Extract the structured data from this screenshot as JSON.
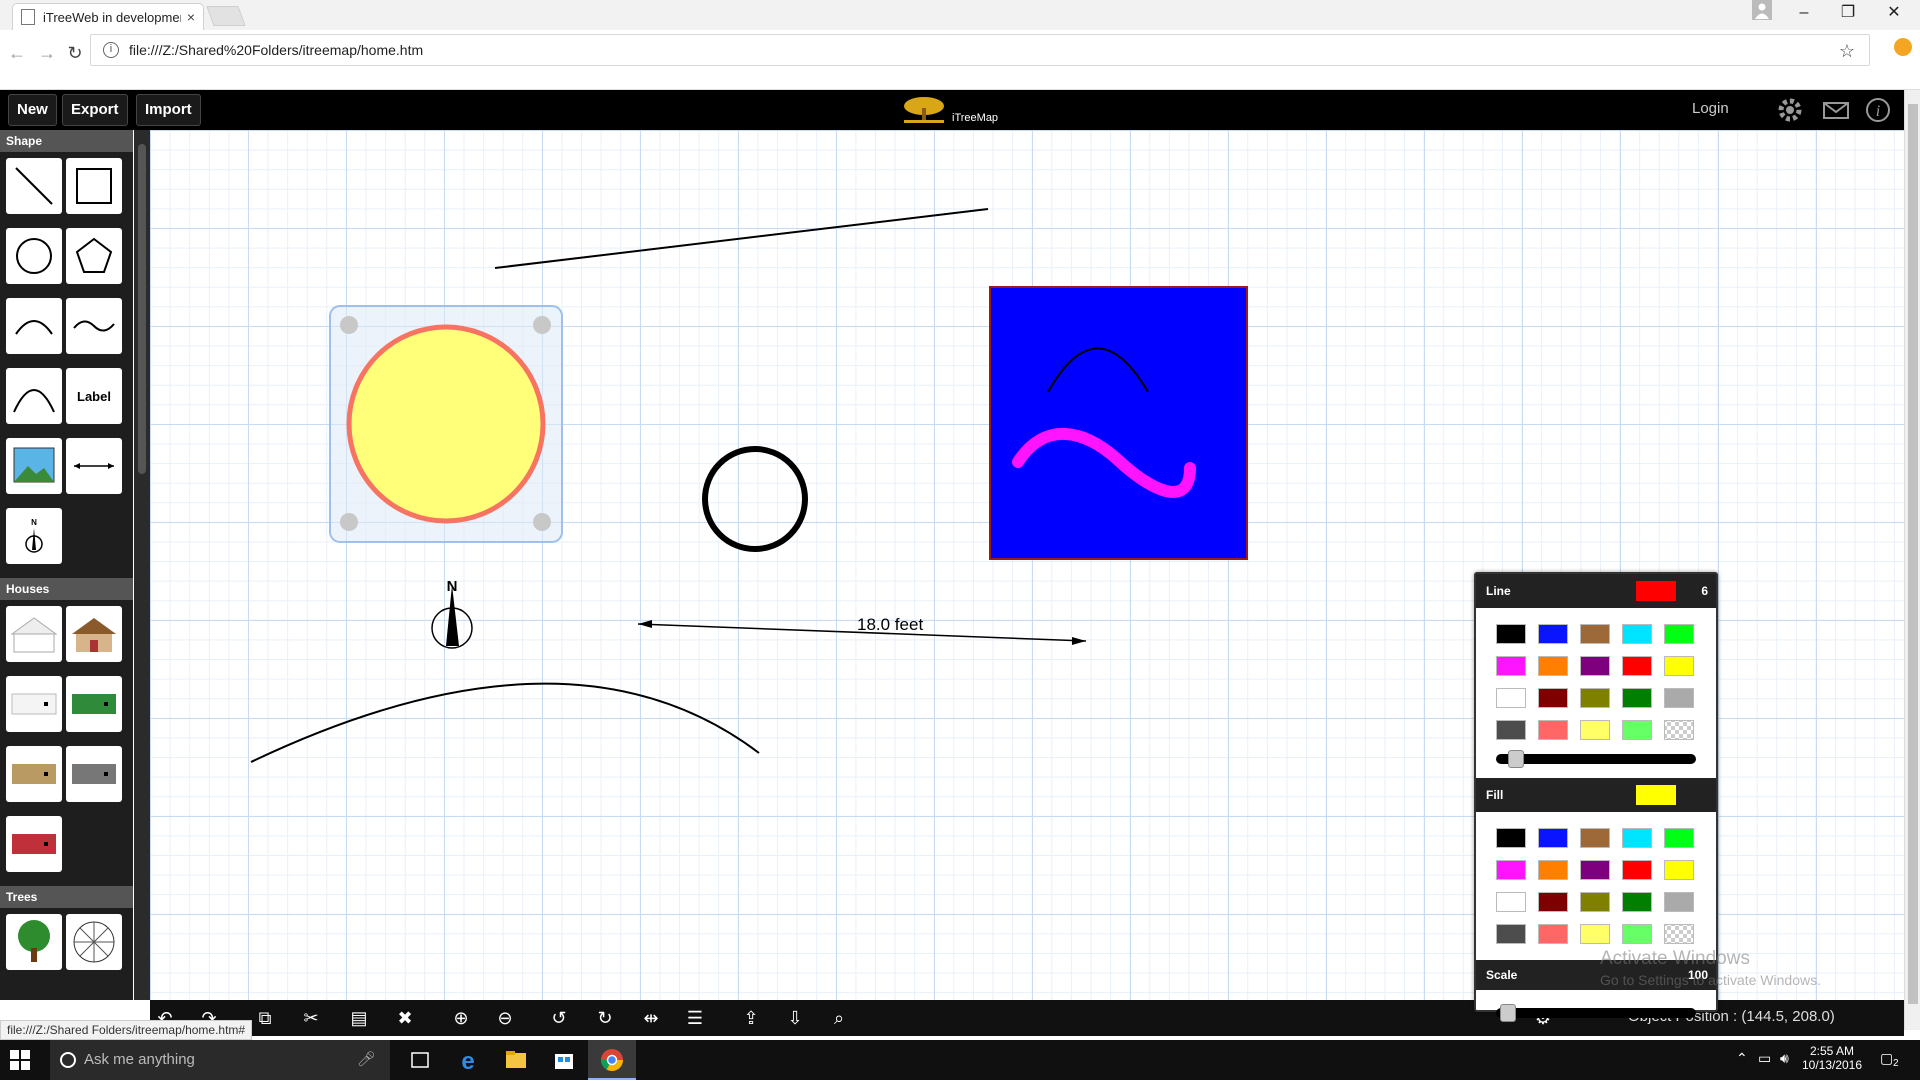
{
  "browser": {
    "tab_title": "iTreeWeb in developmen",
    "tab_close": "×",
    "url": "file:///Z:/Shared%20Folders/itreemap/home.htm",
    "status_url": "file:///Z:/Shared Folders/itreemap/home.htm#"
  },
  "appbar": {
    "new_label": "New",
    "export_label": "Export",
    "import_label": "Import",
    "brand": "iTreeMap",
    "login_label": "Login"
  },
  "sidebar": {
    "sections": [
      "Shape",
      "Houses",
      "Trees"
    ],
    "label_tool_text": "Label",
    "compass_tool_text": "N"
  },
  "canvas": {
    "dimension_label": "18.0 feet",
    "compass_label": "N"
  },
  "panel": {
    "line_label": "Line",
    "line_color": "#ff0000",
    "line_value": "6",
    "fill_label": "Fill",
    "fill_color": "#ffff00",
    "scale_label": "Scale",
    "scale_value": "100",
    "palette": [
      "#000000",
      "#0a14ff",
      "#9e6938",
      "#00e5ff",
      "#00ff14",
      "#ff14ff",
      "#ff8000",
      "#7f007f",
      "#ff0000",
      "#ffff00",
      "#ffffff",
      "#7f0000",
      "#808000",
      "#007f00",
      "#aaaaaa",
      "#4d4d4d",
      "#ff6666",
      "#ffff66",
      "#66ff66",
      "checker"
    ]
  },
  "status": {
    "object_position": "Object Position : (144.5, 208.0)"
  },
  "watermark": {
    "line1": "Activate Windows",
    "line2": "Go to Settings to activate Windows."
  },
  "taskbar": {
    "search_placeholder": "Ask me anything",
    "time": "2:55 AM",
    "date": "10/13/2016",
    "notif_count": "2"
  }
}
